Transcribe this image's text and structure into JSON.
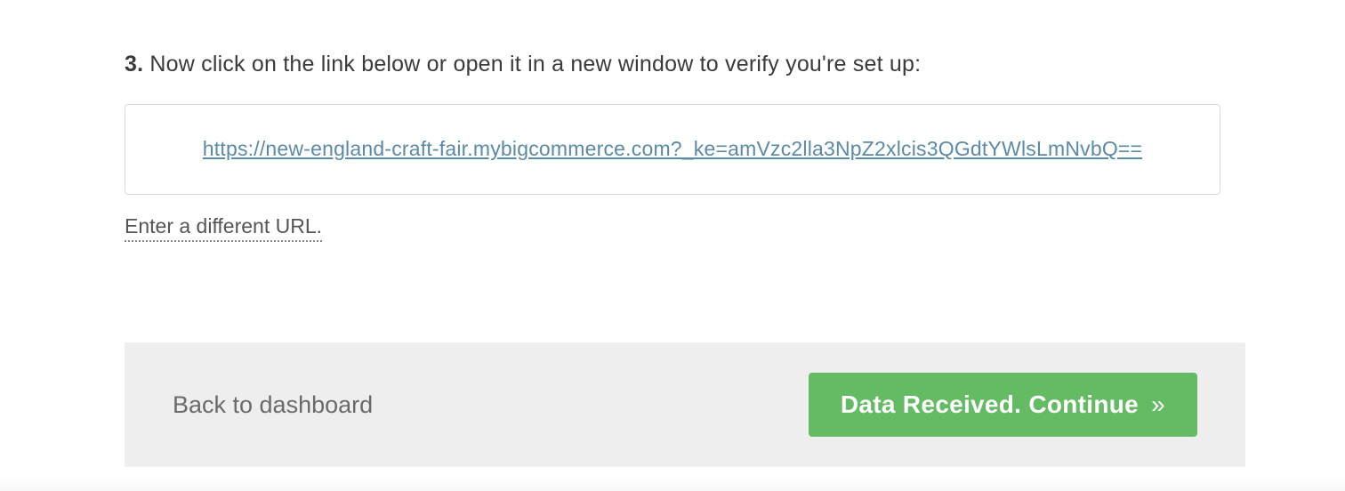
{
  "step": {
    "number": "3.",
    "text": " Now click on the link below or open it in a new window to verify you're set up:"
  },
  "verify_url": "https://new-england-craft-fair.mybigcommerce.com?_ke=amVzc2lla3NpZ2xlcis3QGdtYWlsLmNvbQ==",
  "different_url_label": "Enter a different URL.",
  "footer": {
    "back_label": "Back to dashboard",
    "continue_label": "Data Received. Continue",
    "continue_suffix": " »"
  }
}
